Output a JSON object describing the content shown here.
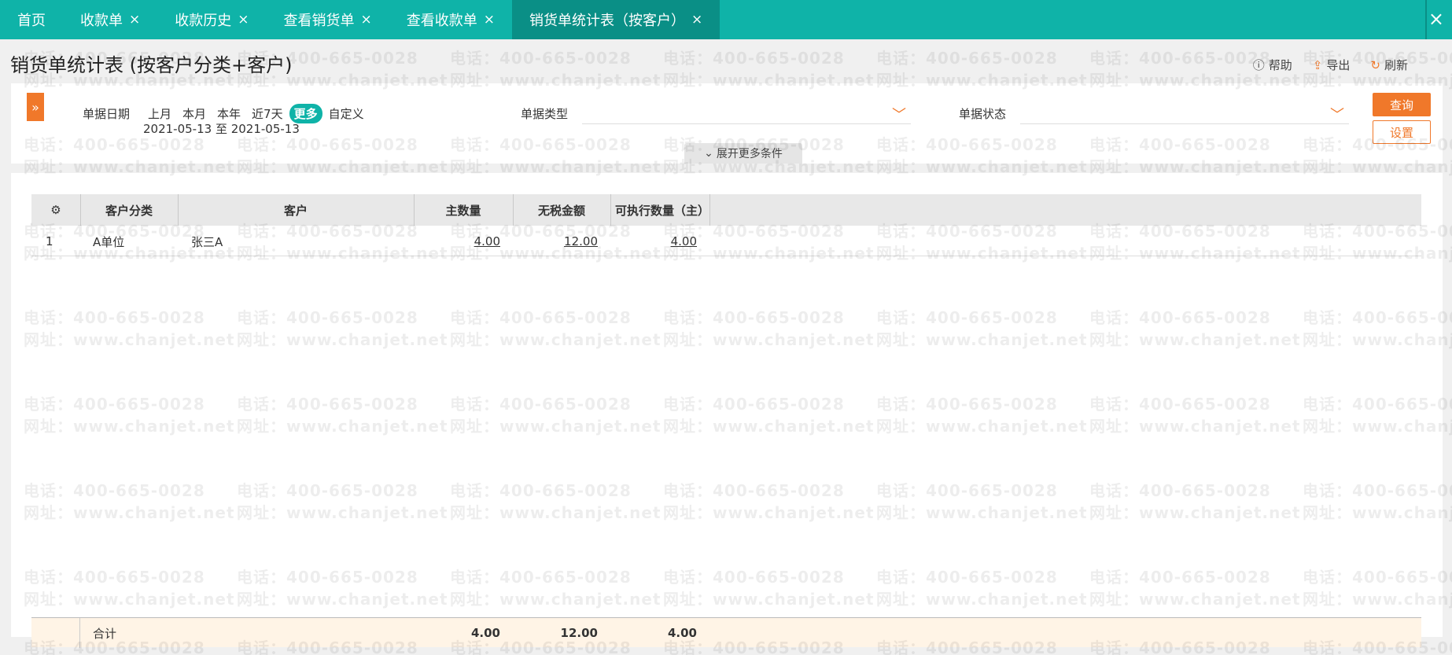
{
  "tabs": [
    {
      "label": "首页",
      "closable": false,
      "active": false
    },
    {
      "label": "收款单",
      "closable": true,
      "active": false
    },
    {
      "label": "收款历史",
      "closable": true,
      "active": false
    },
    {
      "label": "查看销货单",
      "closable": true,
      "active": false
    },
    {
      "label": "查看收款单",
      "closable": true,
      "active": false
    },
    {
      "label": "销货单统计表（按客户）",
      "closable": true,
      "active": true
    }
  ],
  "close_glyph": "×",
  "page_title": "销货单统计表 (按客户分类+客户)",
  "toolbar": {
    "help": "帮助",
    "export": "导出",
    "refresh": "刷新"
  },
  "filters": {
    "date_label": "单据日期",
    "date_chips": [
      "上月",
      "本月",
      "本年",
      "近7天",
      "更多",
      "自定义"
    ],
    "active_chip": "更多",
    "date_range": "2021-05-13 至 2021-05-13",
    "doc_type_label": "单据类型",
    "doc_type_value": "",
    "doc_status_label": "单据状态",
    "doc_status_value": "",
    "query_button": "查询",
    "settings_button": "设置",
    "expand_more": "展开更多条件"
  },
  "table": {
    "columns": [
      "客户分类",
      "客户",
      "主数量",
      "无税金额",
      "可执行数量（主）"
    ],
    "rows": [
      {
        "index": "1",
        "customer_category": "A单位",
        "customer": "张三A",
        "main_qty": "4.00",
        "amount_ex_tax": "12.00",
        "executable_qty": "4.00"
      }
    ],
    "footer": {
      "label": "合计",
      "main_qty": "4.00",
      "amount_ex_tax": "12.00",
      "executable_qty": "4.00"
    }
  },
  "watermark": {
    "phone": "电话：400-665-0028",
    "site": "网址：www.chanjet.net"
  },
  "colors": {
    "tab_bar": "#0fb3a8",
    "tab_active": "#0a8f86",
    "accent_orange": "#f0782a",
    "footer_bg": "#fff4e6"
  }
}
